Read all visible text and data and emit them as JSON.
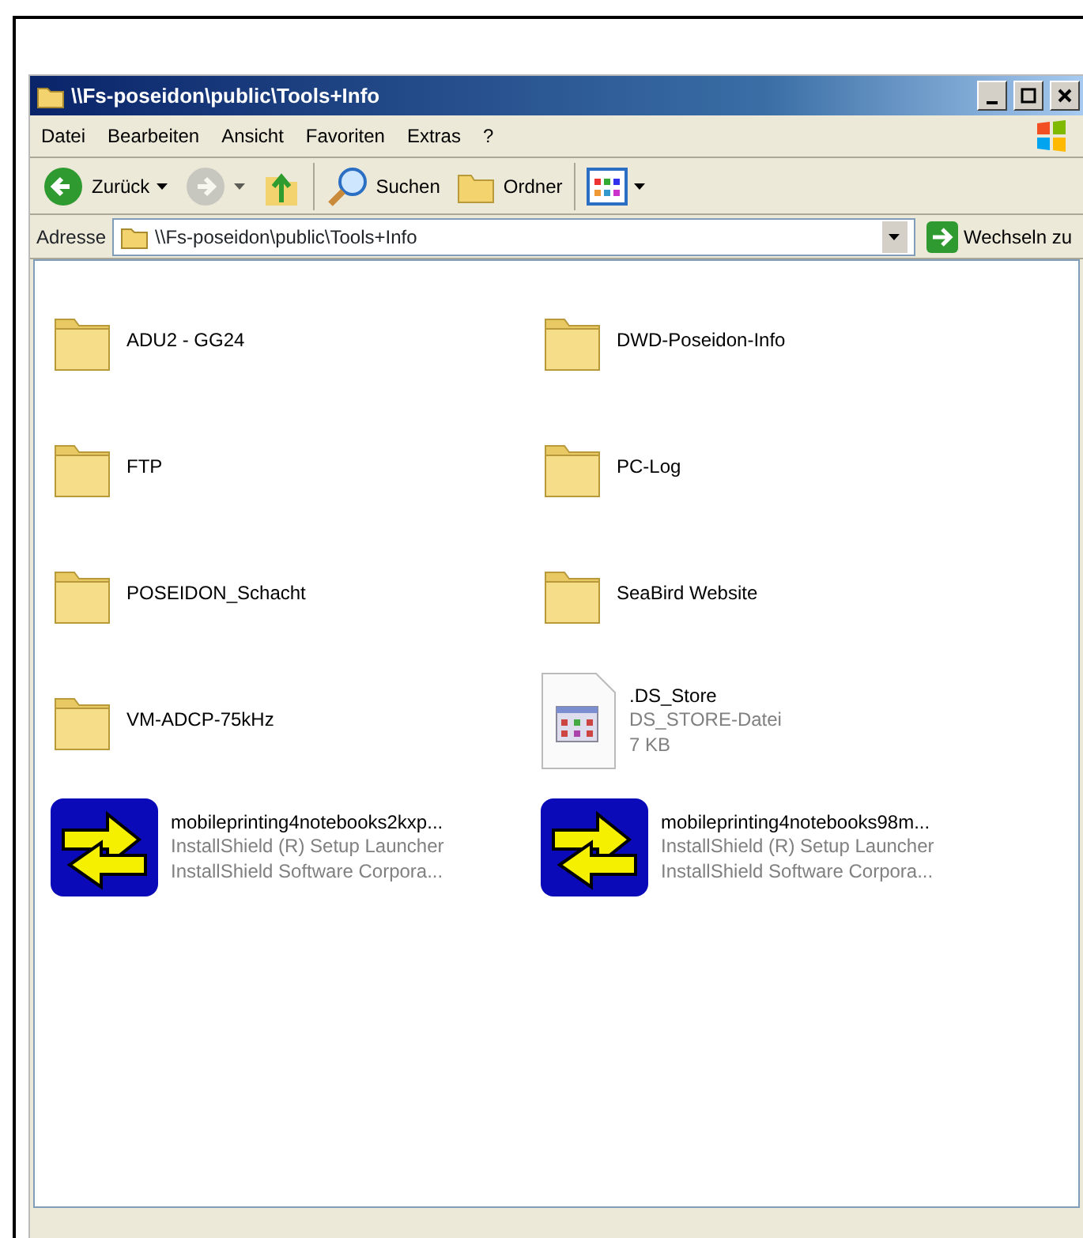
{
  "window": {
    "title": "\\\\Fs-poseidon\\public\\Tools+Info"
  },
  "menu": [
    "Datei",
    "Bearbeiten",
    "Ansicht",
    "Favoriten",
    "Extras",
    "?"
  ],
  "toolbar": [
    {
      "kind": "back",
      "label": "Zurück",
      "disabled": false
    },
    {
      "kind": "forward",
      "disabled": true
    },
    {
      "kind": "up",
      "disabled": false
    },
    {
      "kind": "search",
      "label": "Suchen",
      "disabled": false
    },
    {
      "kind": "folders",
      "label": "Ordner",
      "disabled": false
    },
    {
      "kind": "views",
      "disabled": false
    }
  ],
  "address": {
    "label": "Adresse",
    "value": "\\\\Fs-poseidon\\public\\Tools+Info",
    "go": "Wechseln zu"
  },
  "items": [
    {
      "kind": "folder",
      "name": "ADU2 - GG24"
    },
    {
      "kind": "folder",
      "name": "DWD-Poseidon-Info"
    },
    {
      "kind": "folder",
      "name": "FTP"
    },
    {
      "kind": "folder",
      "name": "PC-Log"
    },
    {
      "kind": "folder",
      "name": "POSEIDON_Schacht"
    },
    {
      "kind": "folder",
      "name": "SeaBird Website"
    },
    {
      "kind": "folder",
      "name": "VM-ADCP-75kHz"
    },
    {
      "kind": "file",
      "name": ".DS_Store",
      "details": [
        "DS_STORE-Datei",
        "7 KB"
      ]
    },
    {
      "kind": "installer",
      "name": "mobileprinting4notebooks2kxp...",
      "details": [
        "InstallShield (R) Setup Launcher",
        "InstallShield Software Corpora..."
      ]
    },
    {
      "kind": "installer",
      "name": "mobileprinting4notebooks98m...",
      "details": [
        "InstallShield (R) Setup Launcher",
        "InstallShield Software Corpora..."
      ]
    }
  ]
}
